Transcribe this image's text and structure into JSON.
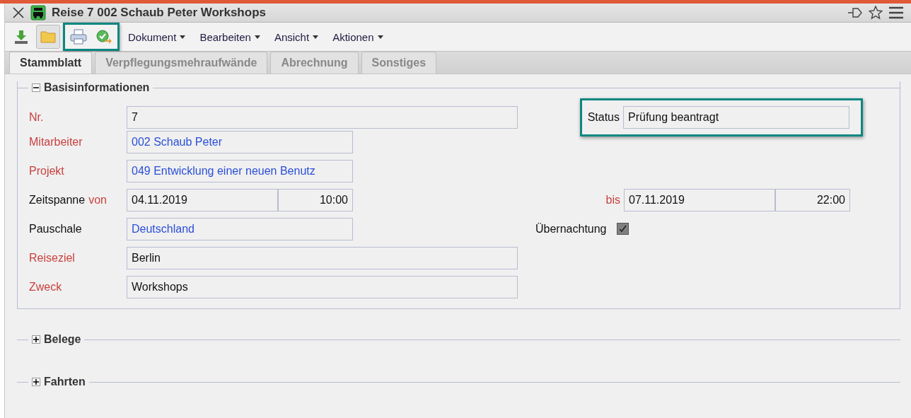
{
  "window": {
    "title": "Reise 7 002 Schaub Peter Workshops"
  },
  "toolbar": {
    "buttons": [
      {
        "kind": "download",
        "highlighted": false,
        "pressed": false
      },
      {
        "kind": "folder",
        "highlighted": false,
        "pressed": true
      },
      {
        "kind": "print",
        "highlighted": true,
        "pressed": false
      },
      {
        "kind": "approve",
        "highlighted": true,
        "pressed": false
      }
    ],
    "menus": [
      "Dokument",
      "Bearbeiten",
      "Ansicht",
      "Aktionen"
    ]
  },
  "tabs": [
    {
      "label": "Stammblatt",
      "selected": true
    },
    {
      "label": "Verpflegungsmehraufwände",
      "selected": false
    },
    {
      "label": "Abrechnung",
      "selected": false
    },
    {
      "label": "Sonstiges",
      "selected": false
    }
  ],
  "sections": [
    {
      "title": "Basisinformationen",
      "expanded": true,
      "rows": [
        {
          "left": {
            "label": "Nr.",
            "required": true,
            "value": "7",
            "linked": false,
            "kind": "wide"
          },
          "right": {
            "kind": "field",
            "label": "Status",
            "required": false,
            "value": "Prüfung beantragt",
            "highlighted": true
          }
        },
        {
          "left": {
            "label": "Mitarbeiter",
            "required": true,
            "value": "002 Schaub Peter",
            "linked": true,
            "kind": "short"
          }
        },
        {
          "left": {
            "label": "Projekt",
            "required": true,
            "value": "049 Entwicklung einer neuen Benutz",
            "linked": true,
            "kind": "short"
          }
        },
        {
          "left": {
            "label": "Zeitspanne",
            "sublabel": "von",
            "required": false,
            "value": "04.11.2019",
            "time": "10:00",
            "linked": false,
            "kind": "datetime"
          },
          "right": {
            "kind": "datetime",
            "label": "bis",
            "required": true,
            "value": "07.11.2019",
            "time": "22:00"
          }
        },
        {
          "left": {
            "label": "Pauschale",
            "required": false,
            "value": "Deutschland",
            "linked": true,
            "kind": "short"
          },
          "right": {
            "kind": "checkbox",
            "label": "Übernachtung",
            "required": false,
            "checked": true
          }
        },
        {
          "left": {
            "label": "Reiseziel",
            "required": true,
            "value": "Berlin",
            "linked": false,
            "kind": "wide"
          }
        },
        {
          "left": {
            "label": "Zweck",
            "required": true,
            "value": "Workshops",
            "linked": false,
            "kind": "wide"
          }
        }
      ]
    },
    {
      "title": "Belege",
      "expanded": false
    },
    {
      "title": "Fahrten",
      "expanded": false
    }
  ]
}
